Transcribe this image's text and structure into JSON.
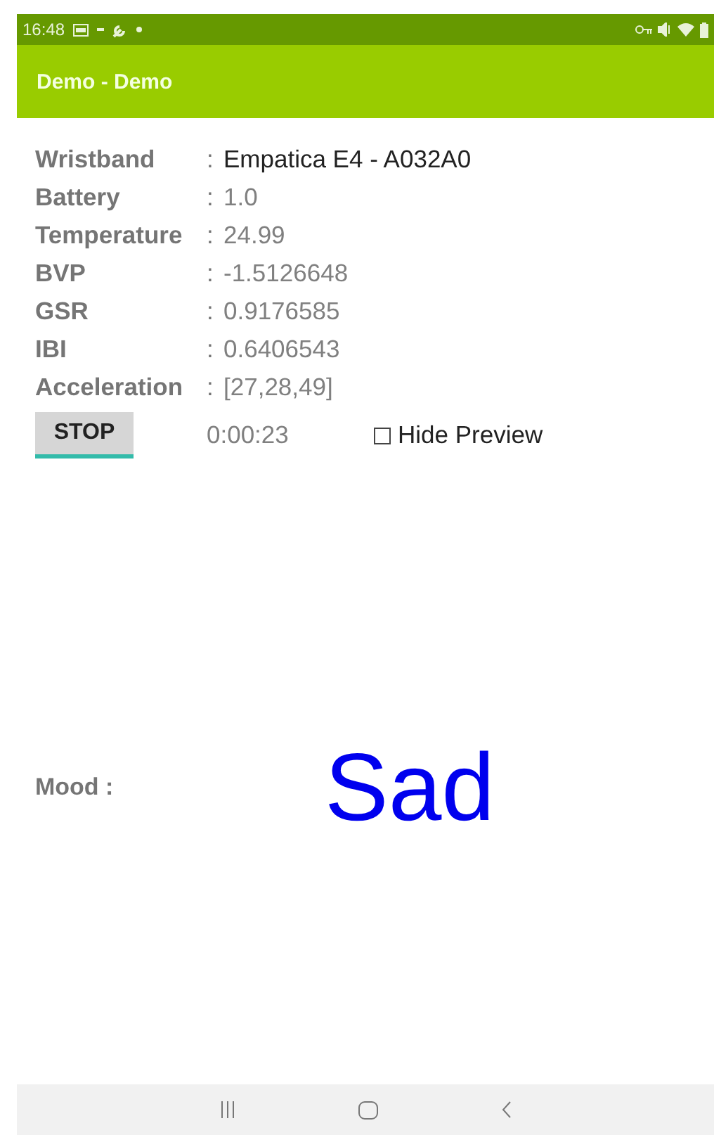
{
  "status_bar": {
    "time": "16:48"
  },
  "app_bar": {
    "title": "Demo  - Demo"
  },
  "fields": [
    {
      "label": "Wristband",
      "separator": ":",
      "value": "Empatica E4 - A032A0",
      "kind": "device"
    },
    {
      "label": "Battery",
      "separator": ":",
      "value": "1.0",
      "kind": "reading"
    },
    {
      "label": "Temperature",
      "separator": ":",
      "value": "24.99",
      "kind": "reading"
    },
    {
      "label": "BVP",
      "separator": ":",
      "value": "-1.5126648",
      "kind": "reading"
    },
    {
      "label": "GSR",
      "separator": ":",
      "value": "0.9176585",
      "kind": "reading"
    },
    {
      "label": "IBI",
      "separator": ":",
      "value": "0.6406543",
      "kind": "reading"
    },
    {
      "label": "Acceleration",
      "separator": ":",
      "value": "[27,28,49]",
      "kind": "reading"
    }
  ],
  "controls": {
    "button": "STOP",
    "timer": "0:00:23",
    "hide_preview": {
      "label": "Hide Preview",
      "checked": false
    }
  },
  "mood": {
    "label": "Mood :",
    "value": "Sad"
  }
}
